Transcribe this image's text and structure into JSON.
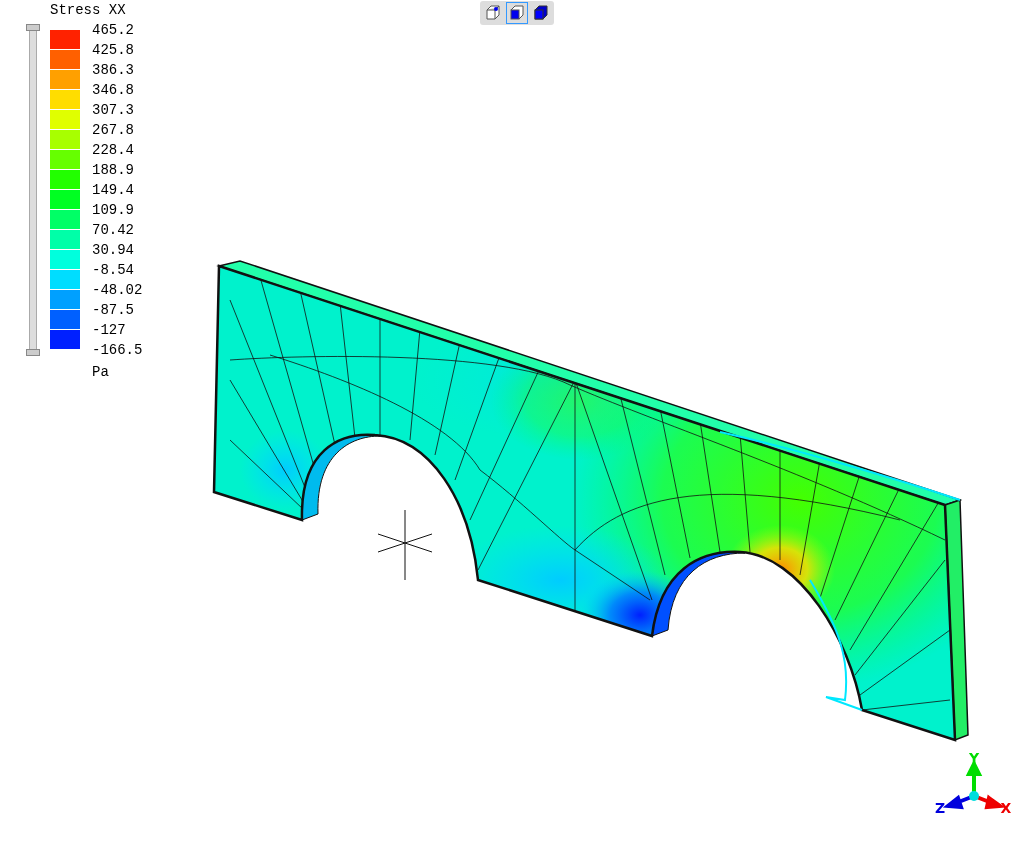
{
  "legend": {
    "title": "Stress XX",
    "unit": "Pa",
    "labels": [
      "465.2",
      "425.8",
      "386.3",
      "346.8",
      "307.3",
      "267.8",
      "228.4",
      "188.9",
      "149.4",
      "109.9",
      "70.42",
      "30.94",
      "-8.54",
      "-48.02",
      "-87.5",
      "-127",
      "-166.5"
    ],
    "bands": [
      {
        "color": "#ff2200"
      },
      {
        "color": "#ff6000"
      },
      {
        "color": "#ffa000"
      },
      {
        "color": "#ffdd00"
      },
      {
        "color": "#e0ff00"
      },
      {
        "color": "#a8ff00"
      },
      {
        "color": "#66ff00"
      },
      {
        "color": "#22ff00"
      },
      {
        "color": "#00ff22"
      },
      {
        "color": "#00ff66"
      },
      {
        "color": "#00ffa8"
      },
      {
        "color": "#00ffdd"
      },
      {
        "color": "#00ddff"
      },
      {
        "color": "#00a0ff"
      },
      {
        "color": "#0060ff"
      },
      {
        "color": "#0020ff"
      }
    ]
  },
  "view_buttons": [
    {
      "kind": "wireframe",
      "selected": false
    },
    {
      "kind": "shaded-edges",
      "selected": true
    },
    {
      "kind": "shaded",
      "selected": false
    }
  ],
  "axes": [
    {
      "kind": "y",
      "label": "Y"
    },
    {
      "kind": "z",
      "label": "Z"
    },
    {
      "kind": "x",
      "label": "X"
    }
  ]
}
